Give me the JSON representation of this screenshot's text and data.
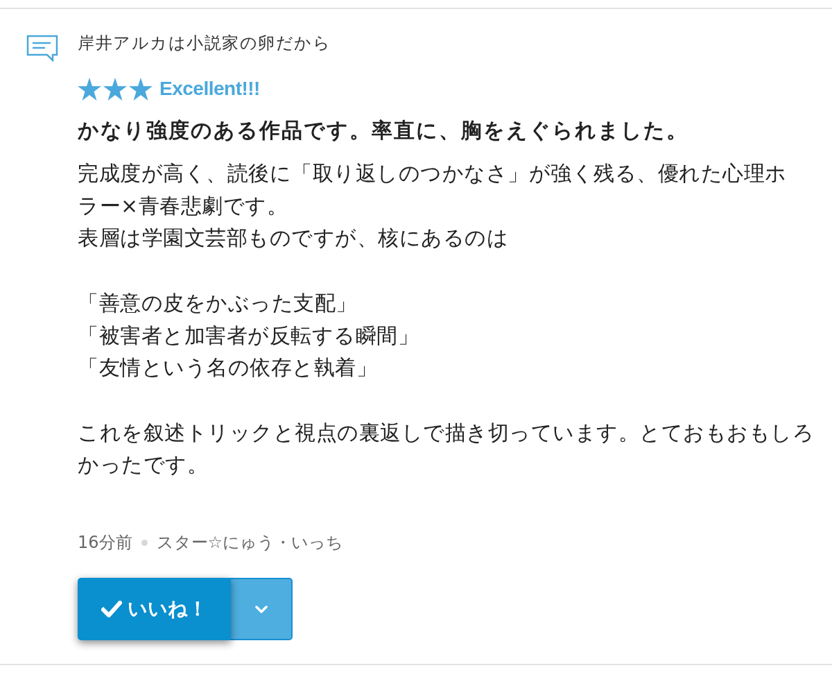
{
  "comment": {
    "title": "岸井アルカは小説家の卵だから"
  },
  "review": {
    "stars": 3,
    "rating_label": "Excellent!!!",
    "headline": "かなり強度のある作品です。率直に、胸をえぐられました。",
    "paragraphs": [
      [
        "完成度が高く、読後に「取り返しのつかなさ」が強く残る、優れた心理ホラー×青春悲劇です。",
        "表層は学園文芸部ものですが、核にあるのは"
      ],
      [
        "「善意の皮をかぶった支配」",
        "「被害者と加害者が反転する瞬間」",
        "「友情という名の依存と執着」"
      ],
      [
        "これを叙述トリックと視点の裏返しで描き切っています。とておもおもしろかったです。"
      ]
    ]
  },
  "meta": {
    "time": "16分前",
    "author": "スター☆にゅう・いっち"
  },
  "like_button": {
    "label": "いいね！"
  }
}
